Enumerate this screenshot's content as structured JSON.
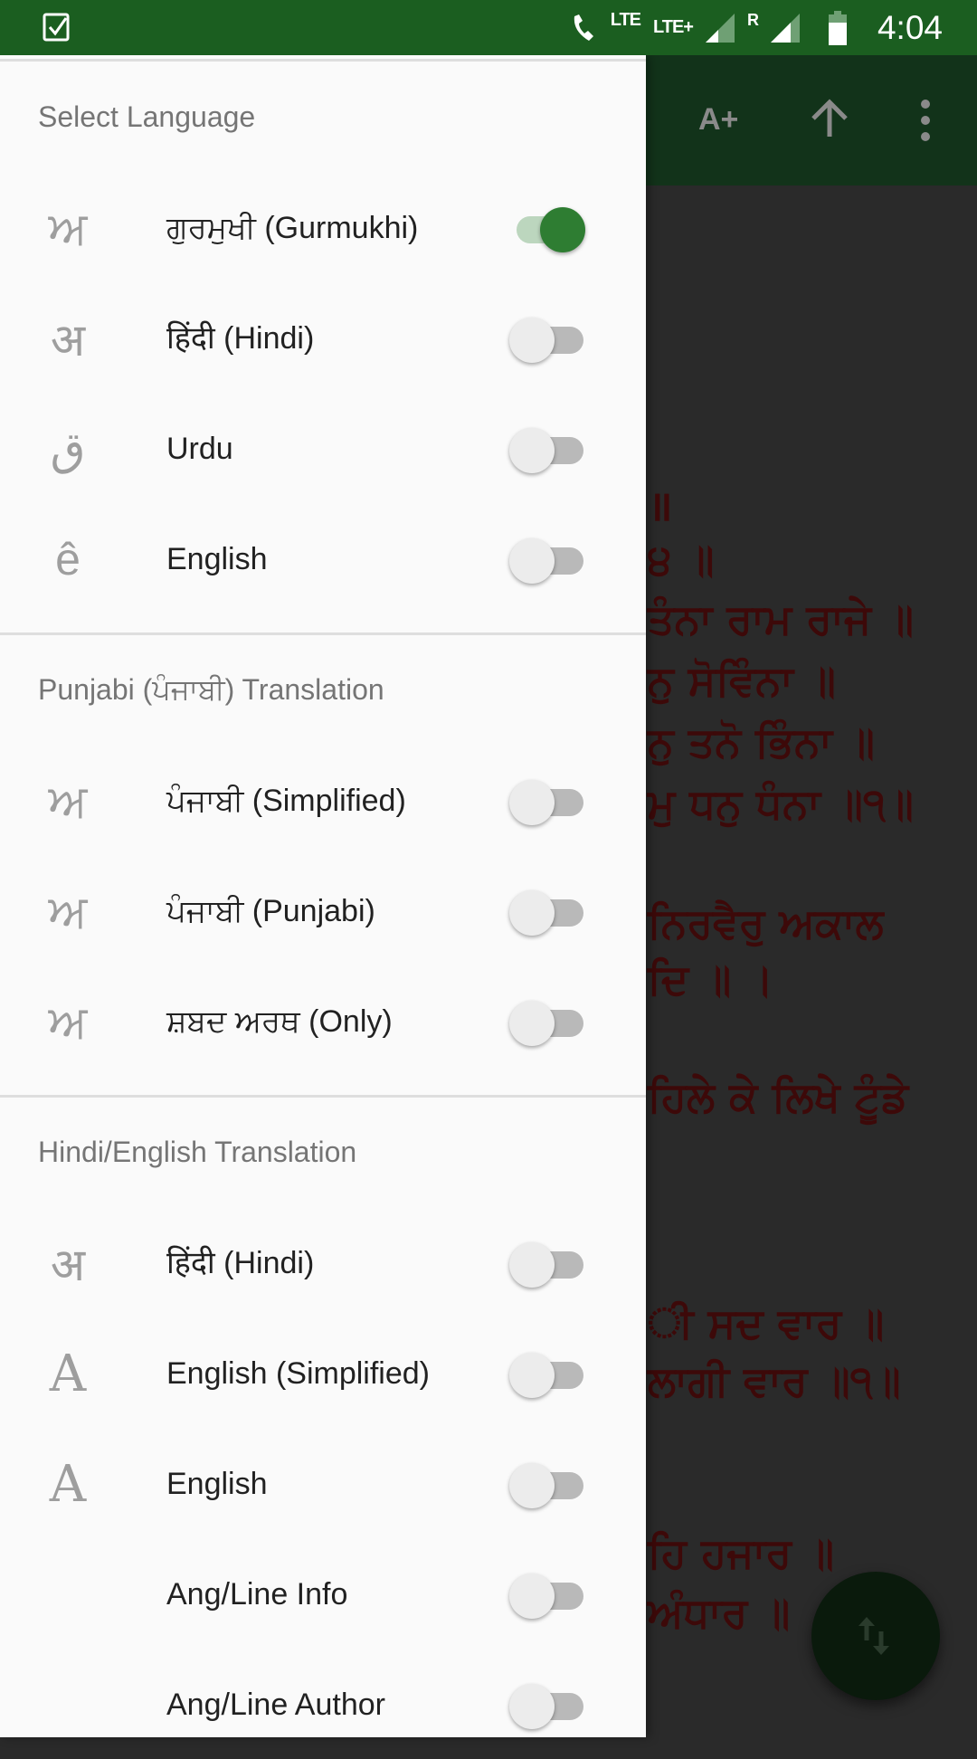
{
  "status_bar": {
    "notification_icon": "checkbox-icon",
    "call_label": "LTE",
    "network_label": "LTE+",
    "roaming_label": "R",
    "time": "4:04"
  },
  "app_bar": {
    "font_size_label": "A+",
    "scroll_top_icon": "arrow-up-icon",
    "more_icon": "more-vert-icon"
  },
  "reading_lines": [
    "॥",
    "੪ ॥",
    "ਤੰਨਾ ਰਾਮ ਰਾਜੇ ॥",
    "ਨੁ ਸੋਵਿੰਨਾ ॥",
    "ਨੁ ਤਨੋ ਭਿੰਨਾ ॥",
    "ਮੁ ਧਨੁ ਧੰਨਾ ॥੧॥",
    "ਨਿਰਵੈਰੁ ਅਕਾਲ",
    "ਦਿ ॥ ।",
    "ਹਿਲੇ ਕੇ ਲਿਖੇ ਟੂੰਡੇ",
    "ੀ ਸਦ ਵਾਰ ॥",
    "ਲਾਗੀ ਵਾਰ ॥੧॥",
    "ਹਿ ਹਜਾਰ ॥",
    "ਅੰਧਾਰ ॥"
  ],
  "fab": {
    "icon": "swap-vertical-icon"
  },
  "drawer": {
    "sections": [
      {
        "title": "Select Language",
        "items": [
          {
            "icon": "ਅ",
            "label": "ਗੁਰਮੁਖੀ (Gurmukhi)",
            "on": true
          },
          {
            "icon": "अ",
            "label": "हिंदी (Hindi)",
            "on": false
          },
          {
            "icon": "ق",
            "label": "Urdu",
            "on": false
          },
          {
            "icon": "ê",
            "label": "English",
            "on": false
          }
        ]
      },
      {
        "title": "Punjabi (ਪੰਜਾਬੀ) Translation",
        "items": [
          {
            "icon": "ਅ",
            "label": "ਪੰਜਾਬੀ (Simplified)",
            "on": false
          },
          {
            "icon": "ਅ",
            "label": "ਪੰਜਾਬੀ (Punjabi)",
            "on": false
          },
          {
            "icon": "ਅ",
            "label": "ਸ਼ਬਦ ਅਰਥ (Only)",
            "on": false
          }
        ]
      },
      {
        "title": "Hindi/English Translation",
        "items": [
          {
            "icon": "अ",
            "label": "हिंदी (Hindi)",
            "on": false
          },
          {
            "icon": "A",
            "label": "English (Simplified)",
            "on": false
          },
          {
            "icon": "A",
            "label": "English",
            "on": false
          },
          {
            "icon": "",
            "label": "Ang/Line Info",
            "on": false
          },
          {
            "icon": "",
            "label": "Ang/Line Author",
            "on": false
          }
        ]
      }
    ]
  },
  "colors": {
    "primary": "#1b5e20",
    "switch_on": "#2e7d32",
    "gurbani_text": "#3d0909"
  }
}
